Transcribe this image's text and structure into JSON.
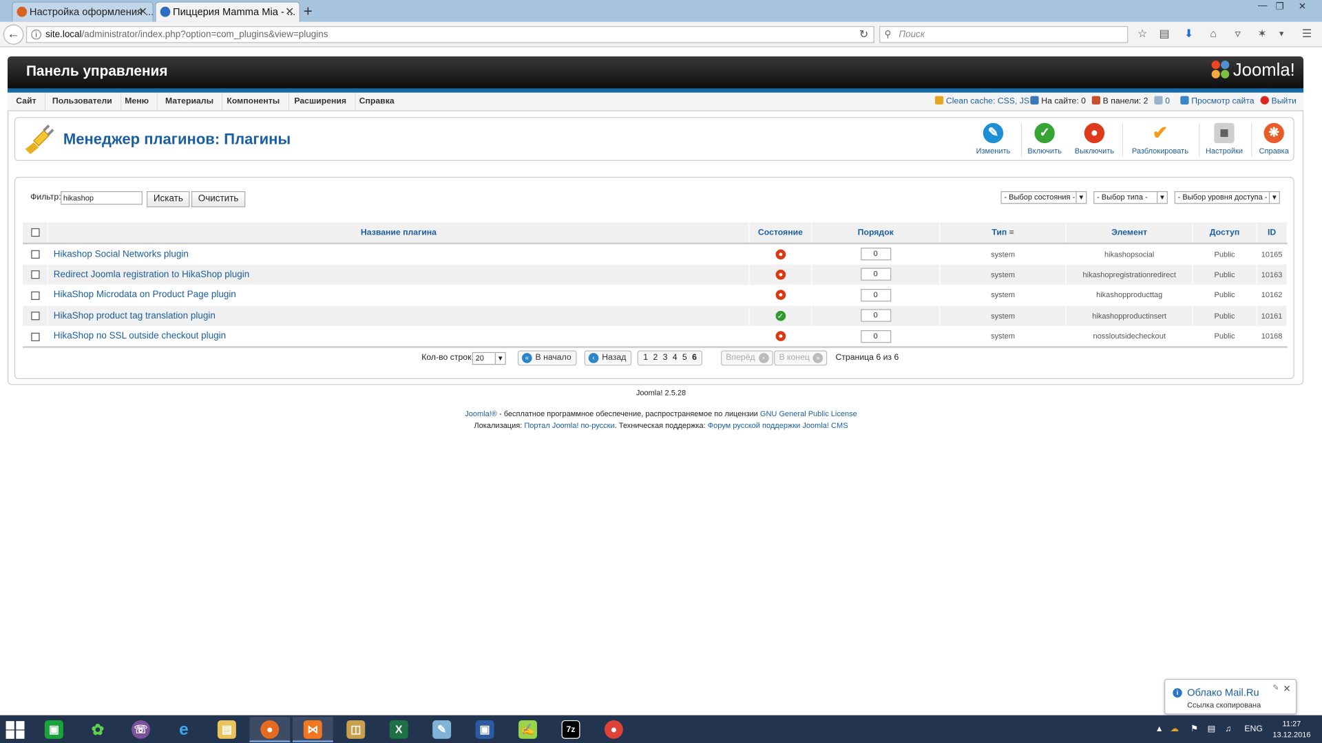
{
  "browser": {
    "tabs": [
      {
        "title": "Настройка оформления ...",
        "close": "✕"
      },
      {
        "title": "Пиццерия Mamma Mia - ...",
        "close": "✕"
      }
    ],
    "new_tab": "+",
    "url_host": "site.local",
    "url_path": "/administrator/index.php?option=com_plugins&view=plugins",
    "search_placeholder": "Поиск"
  },
  "header": {
    "title": "Панель управления",
    "logo_text": "Joomla!"
  },
  "menu": [
    "Сайт",
    "Пользователи",
    "Меню",
    "Материалы",
    "Компоненты",
    "Расширения",
    "Справка"
  ],
  "status": {
    "clean_cache": "Clean cache: CSS, JS",
    "on_site": "На сайте: 0",
    "in_panel": "В панели: 2",
    "messages": "0",
    "view_site": "Просмотр сайта",
    "logout": "Выйти"
  },
  "toolbar": {
    "title": "Менеджер плагинов: Плагины",
    "buttons": [
      "Изменить",
      "Включить",
      "Выключить",
      "Разблокировать",
      "Настройки",
      "Справка"
    ]
  },
  "filter": {
    "label": "Фильтр:",
    "value": "hikashop",
    "search_btn": "Искать",
    "clear_btn": "Очистить",
    "state_select": "- Выбор состояния -",
    "type_select": "- Выбор типа -",
    "access_select": "- Выбор уровня доступа -"
  },
  "table": {
    "headers": {
      "name": "Название плагина",
      "state": "Состояние",
      "order": "Порядок",
      "type": "Тип",
      "element": "Элемент",
      "access": "Доступ",
      "id": "ID"
    },
    "rows": [
      {
        "name": "Hikashop Social Networks plugin",
        "state": "off",
        "order": "0",
        "type": "system",
        "element": "hikashopsocial",
        "access": "Public",
        "id": "10165"
      },
      {
        "name": "Redirect Joomla registration to HikaShop plugin",
        "state": "off",
        "order": "0",
        "type": "system",
        "element": "hikashopregistrationredirect",
        "access": "Public",
        "id": "10163"
      },
      {
        "name": "HikaShop Microdata on Product Page plugin",
        "state": "off",
        "order": "0",
        "type": "system",
        "element": "hikashopproducttag",
        "access": "Public",
        "id": "10162"
      },
      {
        "name": "HikaShop product tag translation plugin",
        "state": "on",
        "order": "0",
        "type": "system",
        "element": "hikashopproductinsert",
        "access": "Public",
        "id": "10161"
      },
      {
        "name": "HikaShop no SSL outside checkout plugin",
        "state": "off",
        "order": "0",
        "type": "system",
        "element": "nossloutsidecheckout",
        "access": "Public",
        "id": "10168"
      }
    ]
  },
  "pagination": {
    "rows_label": "Кол-во строк:",
    "rows_value": "20",
    "start": "В начало",
    "prev": "Назад",
    "pages": [
      "1",
      "2",
      "3",
      "4",
      "5",
      "6"
    ],
    "next": "Вперёд",
    "end": "В конец",
    "page_info": "Страница 6 из 6"
  },
  "footer": {
    "version": "Joomla! 2.5.28",
    "joomla_link": "Joomla!®",
    "license_text": " - бесплатное программное обеспечение, распространяемое по лицензии ",
    "license_link": "GNU General Public License",
    "loc_label": "Локализация: ",
    "portal_link": "Портал Joomla! по-русски",
    "support_label": ". Техническая поддержка: ",
    "forum_link": "Форум русской поддержки Joomla! CMS"
  },
  "notification": {
    "title": "Облако Mail.Ru",
    "text": "Ссылка скопирована"
  },
  "taskbar": {
    "lang": "ENG",
    "time": "11:27",
    "date": "13.12.2016"
  }
}
